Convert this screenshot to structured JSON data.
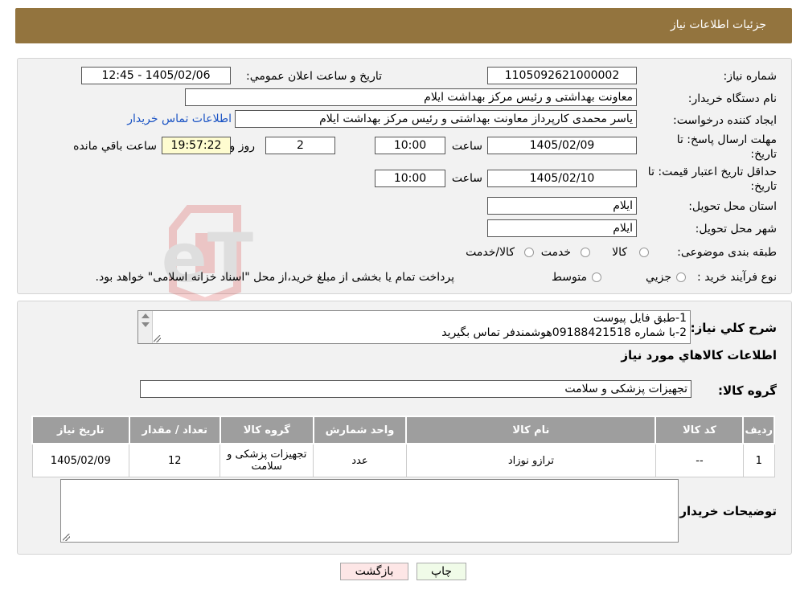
{
  "header": {
    "title": "جزئیات اطلاعات نیاز"
  },
  "form": {
    "need_number_label": "شماره نیاز:",
    "need_number": "1105092621000002",
    "announce_label": "تاریخ و ساعت اعلان عمومي:",
    "announce_value": "1405/02/06 - 12:45",
    "buyer_label": "نام دستگاه خريدار:",
    "buyer_value": "معاونت بهداشتی و رئیس مرکز بهداشت ایلام",
    "creator_label": "ايجاد كننده درخواست:",
    "creator_value": "یاسر محمدی کارپرداز معاونت بهداشتی و رئیس مرکز بهداشت ایلام",
    "contact_link": "اطلاعات تماس خریدار",
    "deadline_label": "مهلت ارسال پاسخ: تا تاريخ:",
    "deadline_date": "1405/02/09",
    "time_label": "ساعت",
    "deadline_time": "10:00",
    "days_value": "2",
    "days_label": "روز و",
    "remaining_time": "19:57:22",
    "remaining_label": "ساعت باقي مانده",
    "validity_label": "حداقل تاريخ اعتبار قيمت: تا تاريخ:",
    "validity_date": "1405/02/10",
    "validity_time": "10:00",
    "province_label": "استان محل تحويل:",
    "province_value": "ایلام",
    "city_label": "شهر محل تحويل:",
    "city_value": "ایلام",
    "category_label": "طبقه بندی موضوعی:",
    "category_options": [
      "کالا",
      "خدمت",
      "کالا/خدمت"
    ],
    "process_label": "نوع فرآيند خريد :",
    "process_options": [
      "جزيي",
      "متوسط"
    ],
    "process_note": "پرداخت تمام یا بخشی از مبلغ خرید،از محل \"اسناد خزانه اسلامی\" خواهد بود."
  },
  "description": {
    "label": "شرح كلي نياز:",
    "line1": "1-طبق فایل پیوست",
    "line2": "2-با شماره 09188421518هوشمندفر تماس بگیرید"
  },
  "goods": {
    "section_title": "اطلاعات كالاهاي مورد نياز",
    "group_label": "گروه كالا:",
    "group_value": "تجهیزات پزشکی و سلامت",
    "columns": [
      "رديف",
      "كد كالا",
      "نام كالا",
      "واحد شمارش",
      "گروه كالا",
      "تعداد / مقدار",
      "تاريخ نياز"
    ],
    "rows": [
      [
        "1",
        "--",
        "ترازو نوزاد",
        "عدد",
        "تجهیزات پزشکی و سلامت",
        "12",
        "1405/02/09"
      ]
    ]
  },
  "buyer_notes": {
    "label": "توضيحات خريدار:"
  },
  "buttons": {
    "print": "چاپ",
    "back": "بازگشت"
  },
  "watermark_text": "AriaTender.neT",
  "colors": {
    "header": "#93743e",
    "table_header": "#9e9e9e",
    "link": "#1a53c4",
    "remaining_bg": "#fefcd0",
    "print_bg": "#f0fbe8",
    "back_bg": "#fde6e6"
  }
}
